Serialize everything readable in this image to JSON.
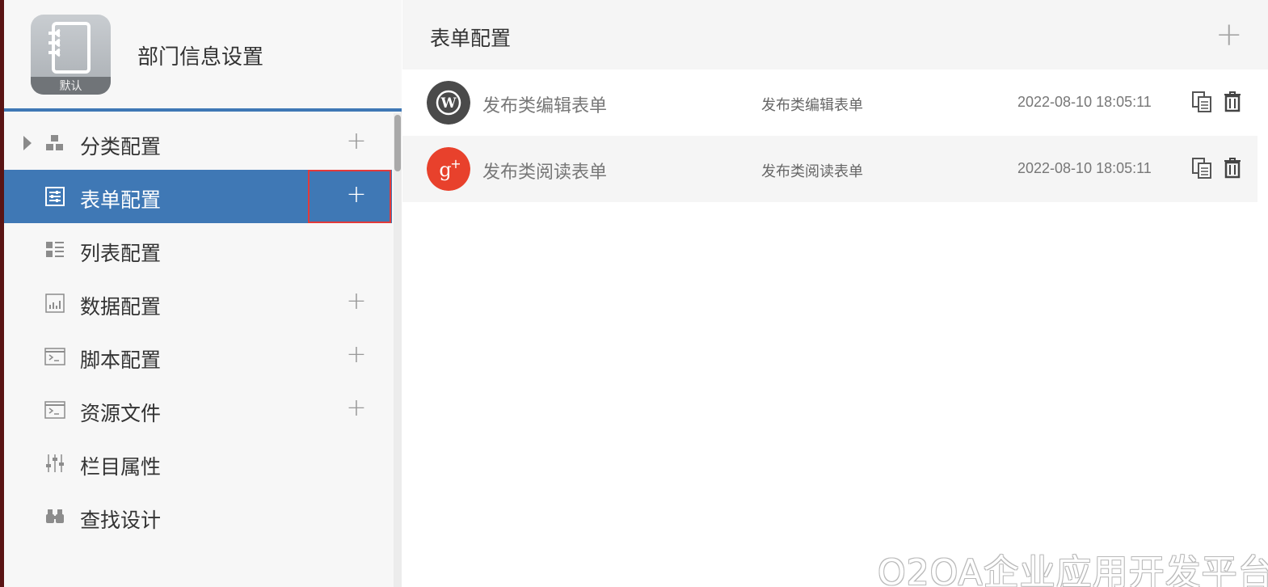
{
  "app": {
    "name": "部门信息设置",
    "icon_badge": "默认",
    "icon": "notebook-icon"
  },
  "sidebar": {
    "items": [
      {
        "label": "分类配置",
        "icon": "category-icon",
        "expandable": true,
        "add": "+"
      },
      {
        "label": "表单配置",
        "icon": "form-icon",
        "active": true,
        "add": "+"
      },
      {
        "label": "列表配置",
        "icon": "list-icon"
      },
      {
        "label": "数据配置",
        "icon": "chart-icon",
        "add": "+"
      },
      {
        "label": "脚本配置",
        "icon": "script-icon",
        "add": "+"
      },
      {
        "label": "资源文件",
        "icon": "resource-icon",
        "add": "+"
      },
      {
        "label": "栏目属性",
        "icon": "sliders-icon"
      },
      {
        "label": "查找设计",
        "icon": "binoculars-icon"
      }
    ]
  },
  "main": {
    "title": "表单配置",
    "add_label": "+",
    "forms": [
      {
        "name": "发布类编辑表单",
        "alias": "发布类编辑表单",
        "time": "2022-08-10 18:05:11",
        "avatar": "wordpress-icon",
        "avatar_color": "#4a4a4a"
      },
      {
        "name": "发布类阅读表单",
        "alias": "发布类阅读表单",
        "time": "2022-08-10 18:05:11",
        "avatar": "google-plus-icon",
        "avatar_color": "#e8412c"
      }
    ]
  },
  "colors": {
    "accent": "#3f78b5",
    "highlight_border": "#e23a3a"
  },
  "watermark": "O2OA企业应用开发平台"
}
